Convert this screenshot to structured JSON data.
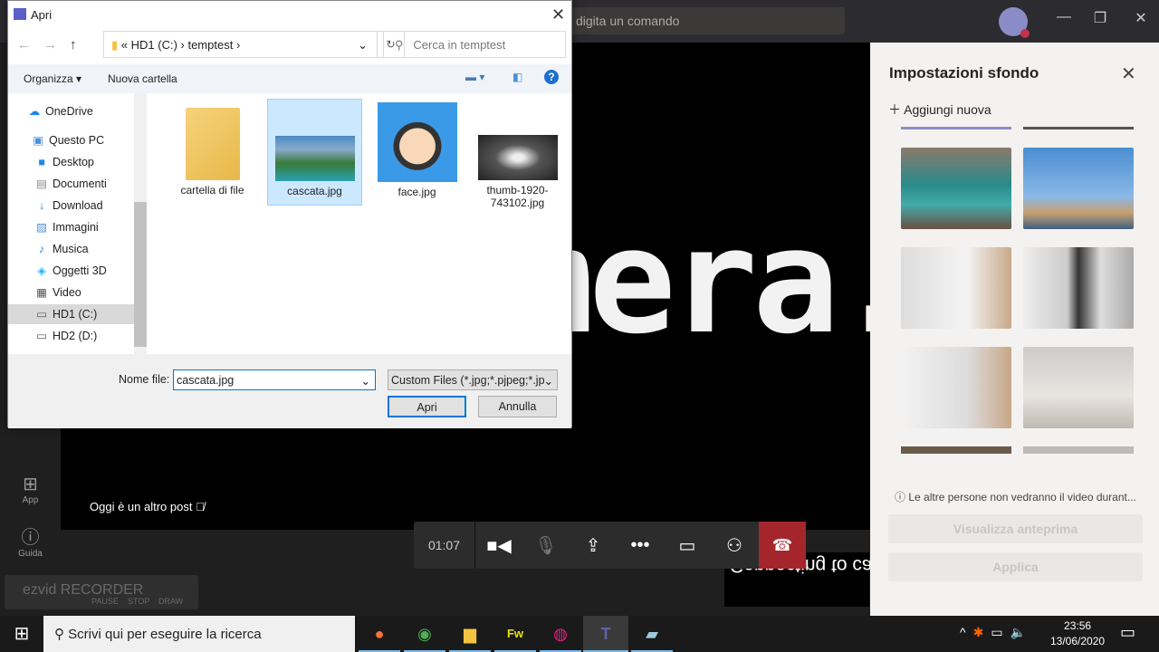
{
  "teams": {
    "command_placeholder": "digita un comando",
    "rail": [
      {
        "label": "App",
        "icon": "apps-icon"
      },
      {
        "label": "Guida",
        "icon": "help-icon"
      }
    ],
    "video_text": "mera...",
    "mirrored_text": "Connecting to camera...",
    "participant": "Oggi è un altro post",
    "timer": "01:07",
    "ezvid": {
      "logo": "ezvid RECORDER",
      "buttons": [
        "PAUSE",
        "STOP",
        "DRAW"
      ]
    }
  },
  "panel": {
    "title": "Impostazioni sfondo",
    "add_new": "Aggiungi nuova",
    "info": "Le altre persone non vedranno il video durant...",
    "preview": "Visualizza anteprima",
    "apply": "Applica"
  },
  "dialog": {
    "title": "Apri",
    "path": [
      "HD1 (C:)",
      "temptest"
    ],
    "search_placeholder": "Cerca in temptest",
    "organize": "Organizza ▾",
    "new_folder": "Nuova cartella",
    "tree": [
      "OneDrive",
      "Questo PC",
      "Desktop",
      "Documenti",
      "Download",
      "Immagini",
      "Musica",
      "Oggetti 3D",
      "Video",
      "HD1 (C:)",
      "HD2 (D:)"
    ],
    "files": [
      {
        "name": "cartella di file"
      },
      {
        "name": "cascata.jpg",
        "selected": true
      },
      {
        "name": "face.jpg"
      },
      {
        "name": "thumb-1920-743102.jpg"
      }
    ],
    "filename_label": "Nome file:",
    "filename": "cascata.jpg",
    "filter": "Custom Files (*.jpg;*.pjpeg;*.jpe",
    "open": "Apri",
    "cancel": "Annulla"
  },
  "taskbar": {
    "search": "Scrivi qui per eseguire la ricerca",
    "time": "23:56",
    "date": "13/06/2020"
  },
  "colors": {
    "hangup": "#a4262c",
    "selection": "#cce8ff",
    "accent": "#0078d7"
  }
}
